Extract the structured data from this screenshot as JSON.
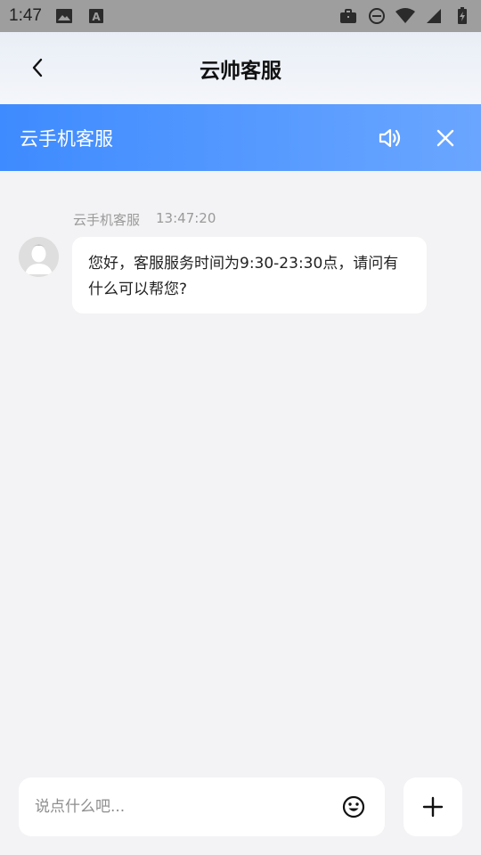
{
  "status_bar": {
    "time": "1:47",
    "left_icons": [
      "image-icon",
      "text-a-icon"
    ],
    "right_icons": [
      "briefcase-icon",
      "dnd-icon",
      "wifi-icon",
      "signal-icon",
      "battery-icon"
    ]
  },
  "header": {
    "title": "云帅客服",
    "back_icon": "chevron-left-icon"
  },
  "banner": {
    "title": "云手机客服",
    "actions": [
      "speaker-icon",
      "close-icon"
    ]
  },
  "messages": [
    {
      "sender": "云手机客服",
      "time": "13:47:20",
      "text": "您好，客服服务时间为9:30-23:30点，请问有什么可以帮您?",
      "avatar_icon": "user-avatar-icon"
    }
  ],
  "composer": {
    "placeholder": "说点什么吧...",
    "value": "",
    "emoji_icon": "smiley-icon",
    "plus_icon": "plus-icon"
  },
  "colors": {
    "banner_start": "#3e8bff",
    "banner_end": "#6aa6ff",
    "background": "#f3f3f5",
    "status_bar": "#9e9e9e"
  }
}
